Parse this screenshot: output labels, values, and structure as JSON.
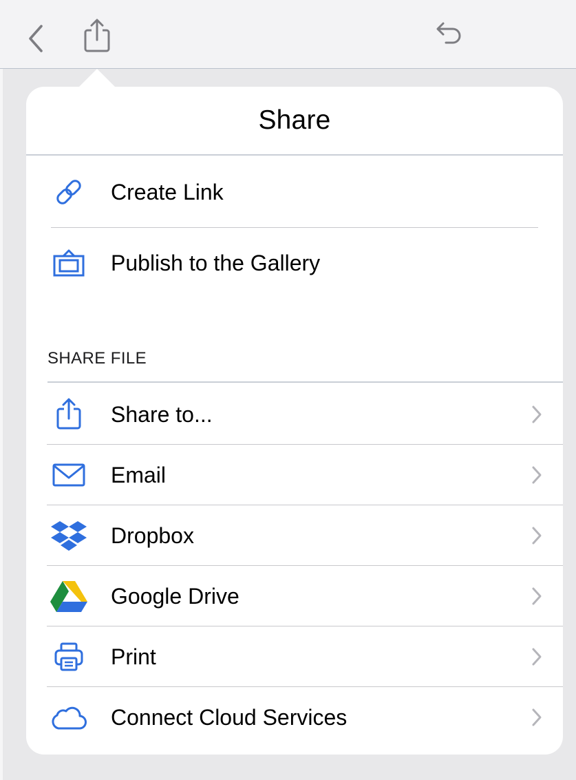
{
  "toolbar": {
    "back_icon": "chevron-left-icon",
    "share_icon": "share-icon",
    "undo_icon": "undo-icon"
  },
  "popover": {
    "title": "Share",
    "items": [
      {
        "label": "Create Link",
        "icon": "link-icon"
      },
      {
        "label": "Publish to the Gallery",
        "icon": "gallery-icon"
      }
    ],
    "section": {
      "header": "SHARE FILE",
      "items": [
        {
          "label": "Share to...",
          "icon": "share-icon"
        },
        {
          "label": "Email",
          "icon": "mail-icon"
        },
        {
          "label": "Dropbox",
          "icon": "dropbox-icon"
        },
        {
          "label": "Google Drive",
          "icon": "google-drive-icon"
        },
        {
          "label": "Print",
          "icon": "printer-icon"
        },
        {
          "label": "Connect Cloud Services",
          "icon": "cloud-icon"
        }
      ]
    }
  },
  "colors": {
    "accent": "#2f6fde",
    "toolbar_icon": "#7d7d82",
    "chevron": "#b5b5ba",
    "separator": "#c8c8cc"
  }
}
